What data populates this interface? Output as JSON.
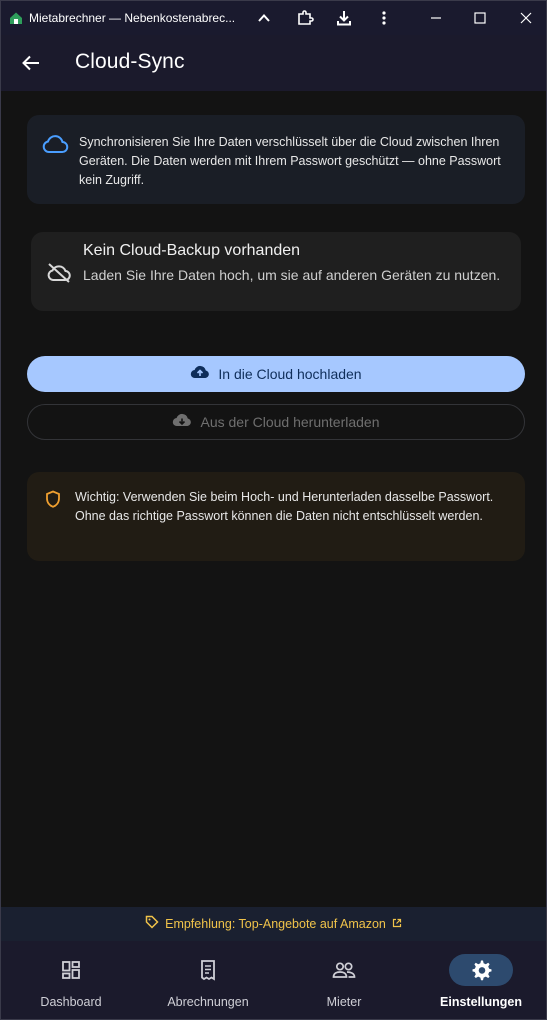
{
  "window": {
    "title": "Mietabrechner — Nebenkostenabrec..."
  },
  "appbar": {
    "title": "Cloud-Sync"
  },
  "info": {
    "text": "Synchronisieren Sie Ihre Daten verschlüsselt über die Cloud zwischen Ihren Geräten. Die Daten werden mit Ihrem Passwort geschützt — ohne Passwort kein Zugriff.",
    "icon": "cloud-icon"
  },
  "status": {
    "title": "Kein Cloud-Backup vorhanden",
    "description": "Laden Sie Ihre Daten hoch, um sie auf anderen Geräten zu nutzen.",
    "icon": "cloud-off-icon"
  },
  "actions": {
    "upload_label": "In die Cloud hochladen",
    "download_label": "Aus der Cloud herunterladen"
  },
  "warning": {
    "text": "Wichtig: Verwenden Sie beim Hoch- und Herunterladen dasselbe Passwort. Ohne das richtige Passwort können die Daten nicht entschlüsselt werden.",
    "icon": "shield-icon"
  },
  "promo": {
    "label": "Empfehlung: Top-Angebote auf Amazon"
  },
  "nav": {
    "items": [
      {
        "label": "Dashboard",
        "icon": "dashboard-icon"
      },
      {
        "label": "Abrechnungen",
        "icon": "receipt-icon"
      },
      {
        "label": "Mieter",
        "icon": "people-icon"
      },
      {
        "label": "Einstellungen",
        "icon": "gear-icon",
        "active": true
      }
    ]
  },
  "colors": {
    "primary": "#a6c8ff",
    "warning": "#f0a030",
    "promo": "#f0c34a",
    "accent_icon": "#4a9eff"
  }
}
